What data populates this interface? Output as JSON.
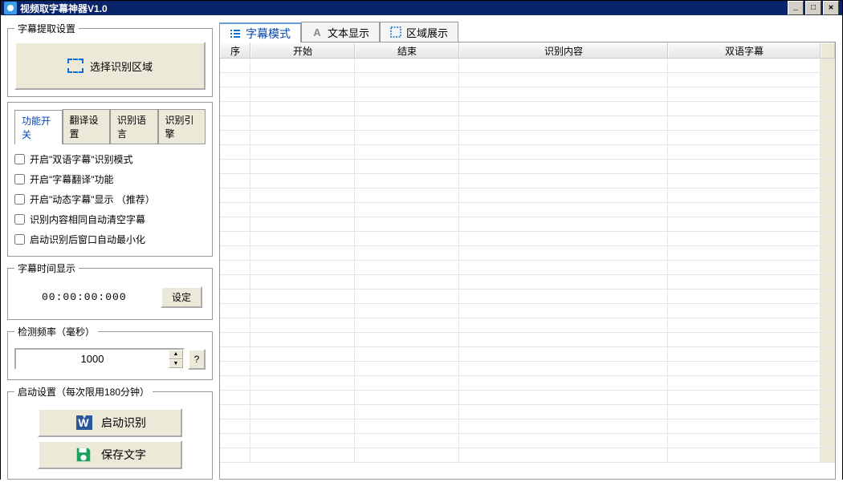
{
  "titlebar": {
    "title": "视频取字幕神器V1.0"
  },
  "leftPanel": {
    "extractGroup": {
      "legend": "字幕提取设置",
      "selectAreaBtn": "选择识别区域"
    },
    "tabs": {
      "items": [
        "功能开关",
        "翻译设置",
        "识别语言",
        "识别引擎"
      ],
      "active": 0
    },
    "checkboxes": [
      "开启\"双语字幕\"识别模式",
      "开启\"字幕翻译\"功能",
      "开启\"动态字幕\"显示  （推荐）",
      "识别内容相同自动清空字幕",
      "启动识别后窗口自动最小化"
    ],
    "timeGroup": {
      "legend": "字幕时间显示",
      "value": "00:00:00:000",
      "setBtn": "设定"
    },
    "freqGroup": {
      "legend": "检测频率（毫秒）",
      "value": "1000",
      "helpBtn": "?"
    },
    "startGroup": {
      "legend": "启动设置（每次限用180分钟）",
      "startBtn": "启动识别",
      "saveBtn": "保存文字"
    }
  },
  "rightPanel": {
    "tabs": [
      {
        "label": "字幕模式",
        "iconColor": "#0a6ed1"
      },
      {
        "label": "文本显示",
        "iconColor": "#888"
      },
      {
        "label": "区域展示",
        "iconColor": "#0a6ed1"
      }
    ],
    "activeTab": 0,
    "columns": [
      "序",
      "开始",
      "结束",
      "识别内容",
      "双语字幕"
    ]
  }
}
